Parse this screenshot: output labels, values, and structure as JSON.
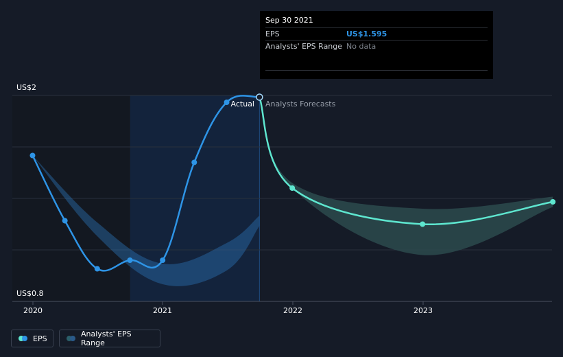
{
  "tooltip": {
    "date": "Sep 30 2021",
    "eps_label": "EPS",
    "eps_value": "US$1.595",
    "range_label": "Analysts' EPS Range",
    "range_value": "No data"
  },
  "regions": {
    "actual": "Actual",
    "forecast": "Analysts Forecasts"
  },
  "legend": {
    "eps": "EPS",
    "range": "Analysts' EPS Range"
  },
  "colors": {
    "actual_line": "#2e94e6",
    "forecast_line": "#5ee6cf",
    "band": "#2a6fb0",
    "forecast_band": "#2b4a4d",
    "background": "#151b27"
  },
  "chart_data": {
    "type": "line",
    "ylim": [
      0.8,
      2.0
    ],
    "y_tick_labels": {
      "top": "US$2",
      "bottom": "US$0.8"
    },
    "x_ticks": [
      "2020",
      "2021",
      "2022",
      "2023"
    ],
    "x_range": [
      "2020-01-01",
      "2023-12-31"
    ],
    "grid": true,
    "series": [
      {
        "name": "Actual",
        "points": [
          {
            "x": "2019-12-31",
            "y": 1.65
          },
          {
            "x": "2020-03-31",
            "y": 1.27
          },
          {
            "x": "2020-06-30",
            "y": 0.99
          },
          {
            "x": "2020-09-30",
            "y": 1.04
          },
          {
            "x": "2020-12-31",
            "y": 1.04
          },
          {
            "x": "2021-03-31",
            "y": 1.61
          },
          {
            "x": "2021-06-30",
            "y": 1.96
          },
          {
            "x": "2021-09-30",
            "y": 1.99
          }
        ]
      },
      {
        "name": "Analysts Forecasts",
        "points": [
          {
            "x": "2021-09-30",
            "y": 1.99
          },
          {
            "x": "2021-12-31",
            "y": 1.46
          },
          {
            "x": "2022-12-31",
            "y": 1.25
          },
          {
            "x": "2023-12-31",
            "y": 1.38
          }
        ]
      }
    ],
    "past_band": [
      {
        "x": "2019-12-31",
        "low": 1.65,
        "high": 1.65
      },
      {
        "x": "2020-06-30",
        "low": 1.18,
        "high": 1.26
      },
      {
        "x": "2020-12-31",
        "low": 0.9,
        "high": 1.02
      },
      {
        "x": "2021-06-30",
        "low": 0.98,
        "high": 1.14
      },
      {
        "x": "2021-09-30",
        "low": 1.24,
        "high": 1.3
      }
    ],
    "forecast_band": [
      {
        "x": "2021-12-31",
        "low": 1.46,
        "high": 1.49
      },
      {
        "x": "2022-12-31",
        "low": 1.07,
        "high": 1.34
      },
      {
        "x": "2023-12-31",
        "low": 1.35,
        "high": 1.41
      }
    ]
  }
}
